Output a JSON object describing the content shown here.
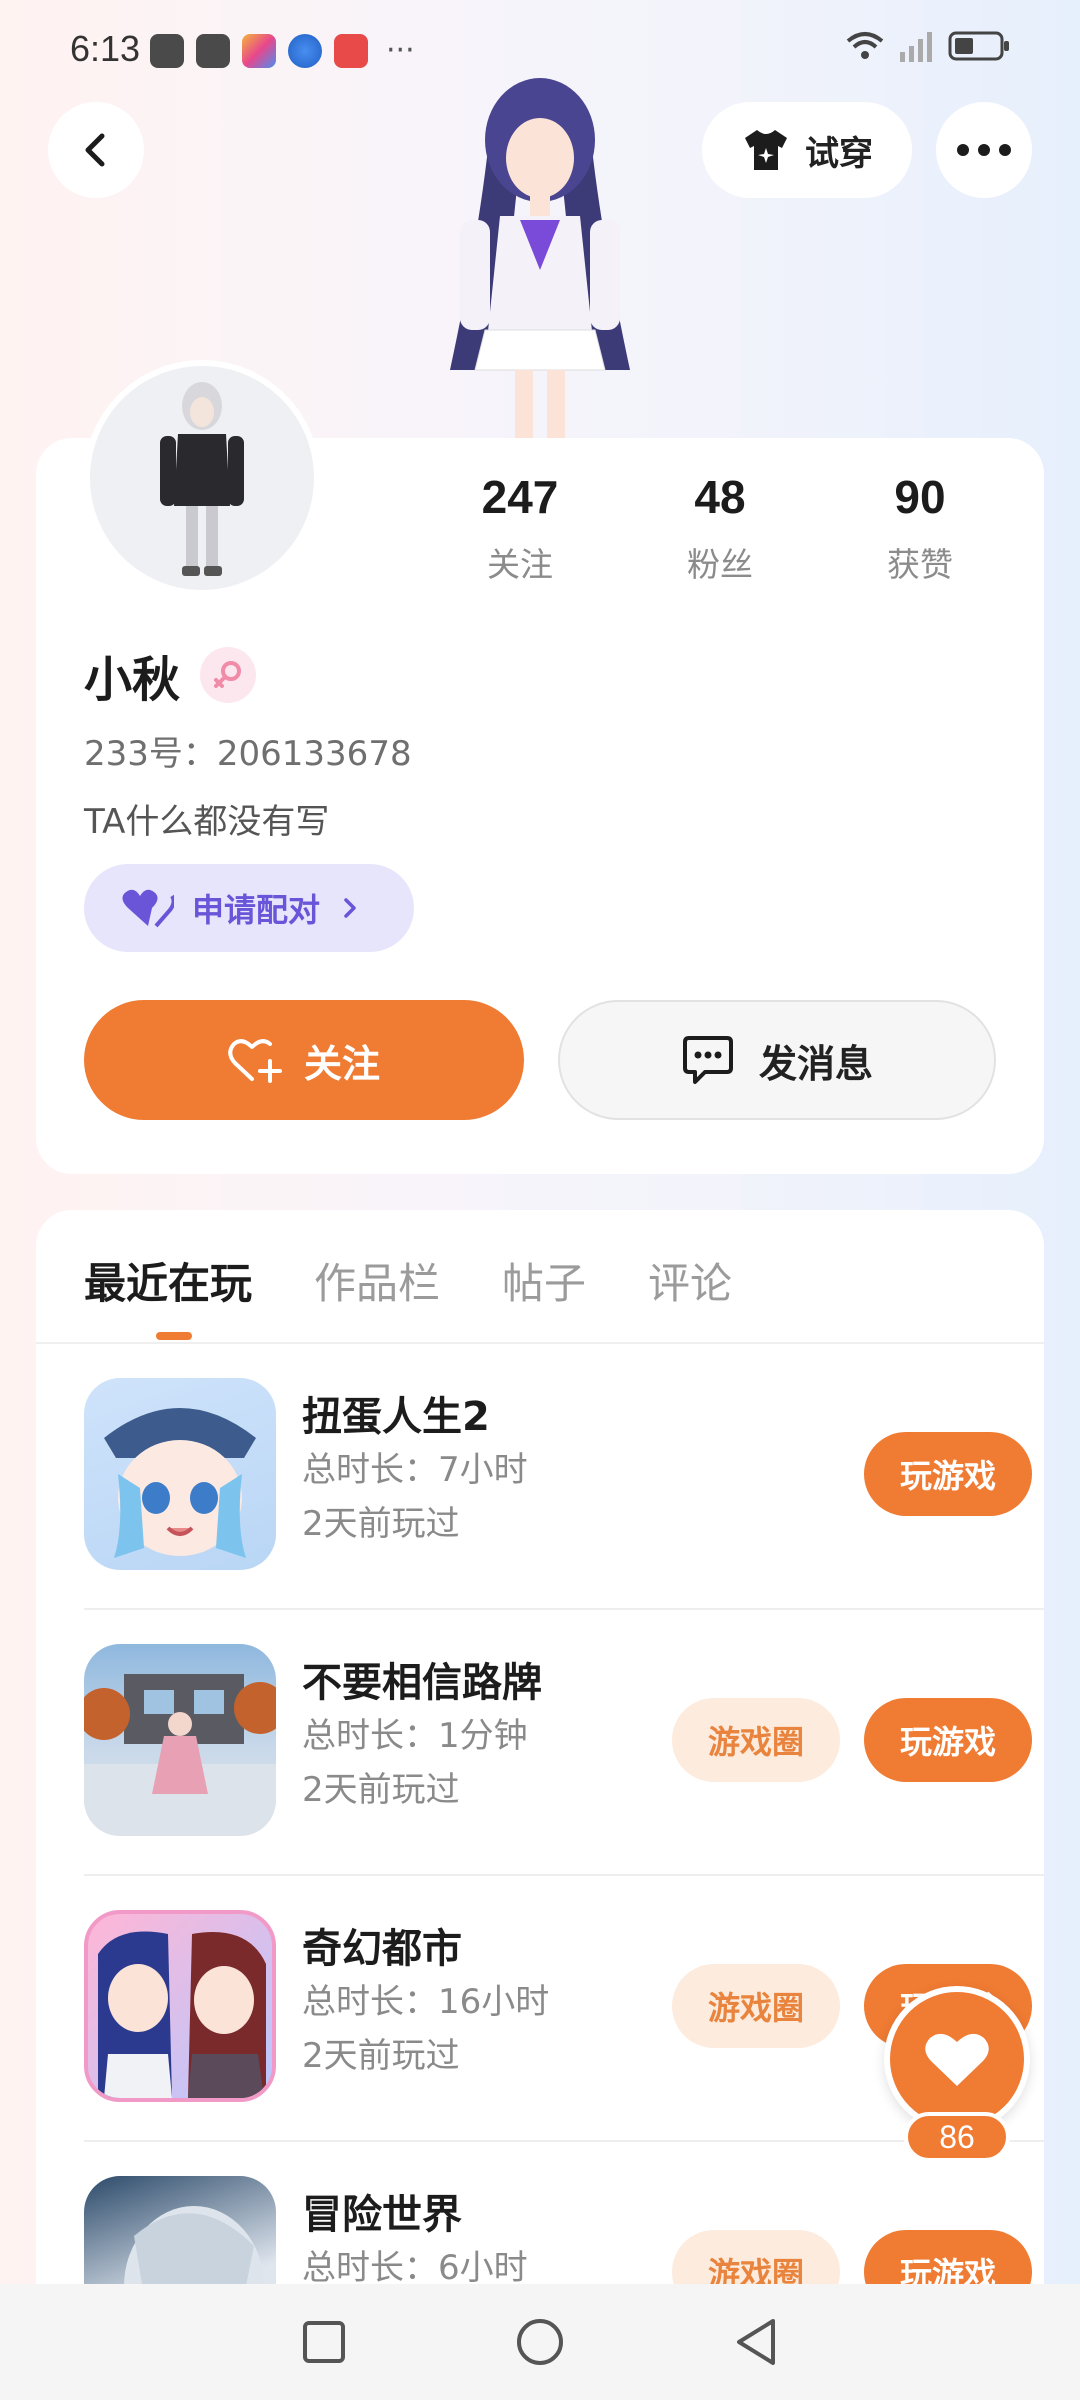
{
  "status_bar": {
    "time": "6:13",
    "more": "···"
  },
  "header": {
    "tryon_label": "试穿"
  },
  "profile": {
    "name": "小秋",
    "id_text": "233号：206133678",
    "bio": "TA什么都没有写",
    "pair_label": "申请配对",
    "stats": [
      {
        "value": "247",
        "label": "关注"
      },
      {
        "value": "48",
        "label": "粉丝"
      },
      {
        "value": "90",
        "label": "获赞"
      }
    ],
    "follow_label": "关注",
    "message_label": "发消息"
  },
  "tabs": [
    "最近在玩",
    "作品栏",
    "帖子",
    "评论"
  ],
  "games": [
    {
      "name": "扭蛋人生2",
      "time": "总时长：7小时",
      "last": "2天前玩过",
      "circle": "",
      "play": "玩游戏"
    },
    {
      "name": "不要相信路牌",
      "time": "总时长：1分钟",
      "last": "2天前玩过",
      "circle": "游戏圈",
      "play": "玩游戏"
    },
    {
      "name": "奇幻都市",
      "time": "总时长：16小时",
      "last": "2天前玩过",
      "circle": "游戏圈",
      "play": "玩游戏"
    },
    {
      "name": "冒险世界",
      "time": "总时长：6小时",
      "last": "",
      "circle": "游戏圈",
      "play": "玩游戏"
    }
  ],
  "like": {
    "count": "86"
  },
  "colors": {
    "accent": "#f07b33",
    "pair_purple": "#6a55d9"
  }
}
